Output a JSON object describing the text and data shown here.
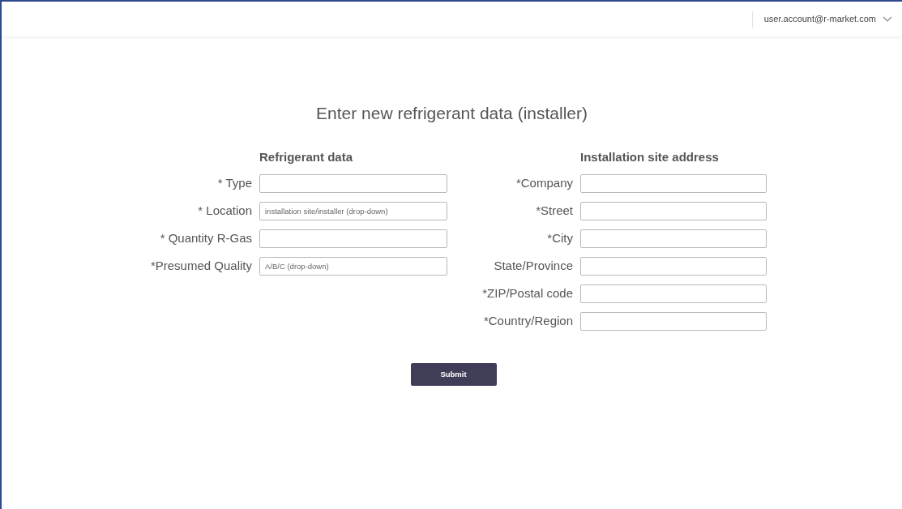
{
  "header": {
    "account": "user.account@r-market.com"
  },
  "title": "Enter new refrigerant data (installer)",
  "sections": [
    {
      "heading": "Refrigerant data",
      "fields": [
        {
          "label": "* Type"
        },
        {
          "label": "* Location",
          "placeholder": "installation site/installer (drop-down)"
        },
        {
          "label": "* Quantity R-Gas"
        },
        {
          "label": "*Presumed Quality",
          "placeholder": "A/B/C (drop-down)"
        }
      ]
    },
    {
      "heading": "Installation site address",
      "fields": [
        {
          "label": "*Company"
        },
        {
          "label": "*Street"
        },
        {
          "label": "*City"
        },
        {
          "label": "State/Province"
        },
        {
          "label": "*ZIP/Postal code"
        },
        {
          "label": "*Country/Region"
        }
      ]
    }
  ],
  "submit": "Submit"
}
